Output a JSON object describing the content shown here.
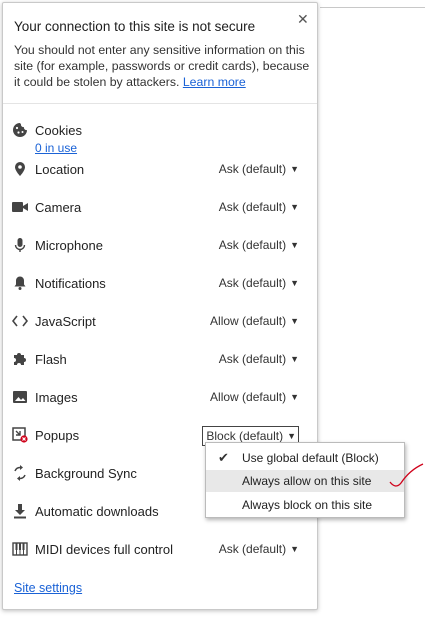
{
  "popup": {
    "title": "Your connection to this site is not secure",
    "close_icon": "close-icon",
    "description": "You should not enter any sensitive information on this site (for example, passwords or credit cards), because it could be stolen by attackers.",
    "learn_more": "Learn more"
  },
  "permissions": [
    {
      "label": "Cookies",
      "icon": "cookie-icon",
      "sub": "0 in use"
    },
    {
      "label": "Location",
      "icon": "location-pin-icon",
      "value": "Ask (default)"
    },
    {
      "label": "Camera",
      "icon": "camera-icon",
      "value": "Ask (default)"
    },
    {
      "label": "Microphone",
      "icon": "microphone-icon",
      "value": "Ask (default)"
    },
    {
      "label": "Notifications",
      "icon": "bell-icon",
      "value": "Ask (default)"
    },
    {
      "label": "JavaScript",
      "icon": "code-brackets-icon",
      "value": "Allow (default)"
    },
    {
      "label": "Flash",
      "icon": "puzzle-icon",
      "value": "Ask (default)"
    },
    {
      "label": "Images",
      "icon": "image-icon",
      "value": "Allow (default)"
    },
    {
      "label": "Popups",
      "icon": "blocked-popup-icon",
      "value": "Block (default)"
    },
    {
      "label": "Background Sync",
      "icon": "sync-icon"
    },
    {
      "label": "Automatic downloads",
      "icon": "download-icon"
    },
    {
      "label": "MIDI devices full control",
      "icon": "piano-keys-icon",
      "value": "Ask (default)"
    }
  ],
  "dropdown": {
    "options": [
      "Use global default (Block)",
      "Always allow on this site",
      "Always block on this site"
    ],
    "checked_index": 0,
    "hover_index": 1
  },
  "site_settings": "Site settings",
  "colors": {
    "link": "#1a62d6",
    "annotation": "#d0021b"
  }
}
